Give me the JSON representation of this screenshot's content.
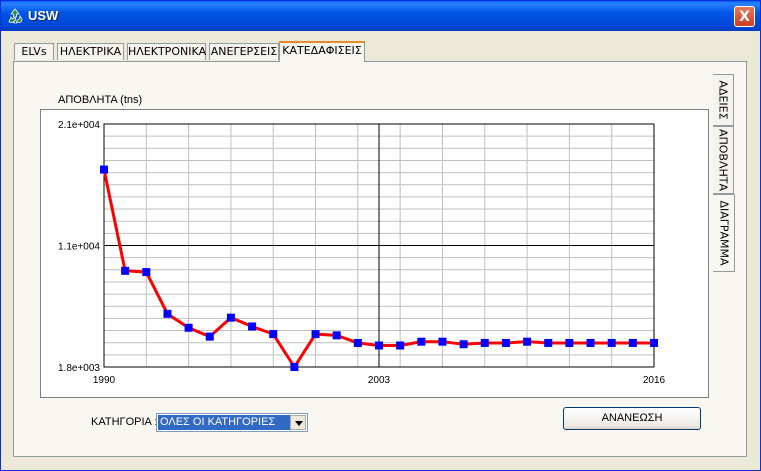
{
  "window": {
    "title": "USW",
    "close_label": "X",
    "icon": "recycle-icon"
  },
  "tabs": [
    {
      "label": "ELVs",
      "active": false
    },
    {
      "label": "ΗΛΕΚΤΡΙΚΑ",
      "active": false
    },
    {
      "label": "ΗΛΕΚΤΡΟΝΙΚΑ",
      "active": false
    },
    {
      "label": "ΑΝΕΓΕΡΣΕΙΣ",
      "active": false
    },
    {
      "label": "ΚΑΤΕΔΑΦΙΣΕΙΣ",
      "active": true
    }
  ],
  "side_tabs": [
    {
      "label": "ΑΔΕΙΕΣ",
      "active": false
    },
    {
      "label": "ΑΠΟΒΛΗΤΑ",
      "active": false
    },
    {
      "label": "ΔΙΑΓΡΑΜΜΑ",
      "active": true
    }
  ],
  "chart_data": {
    "type": "line",
    "ylabel": "ΑΠΟΒΛΗΤΑ (tns)",
    "x": [
      1990,
      1991,
      1992,
      1993,
      1994,
      1995,
      1996,
      1997,
      1998,
      1999,
      2000,
      2001,
      2002,
      2003,
      2004,
      2005,
      2006,
      2007,
      2008,
      2009,
      2010,
      2011,
      2012,
      2013,
      2014,
      2015,
      2016
    ],
    "series": [
      {
        "values": [
          17400,
          9400,
          9300,
          6000,
          4900,
          4200,
          5700,
          5000,
          4400,
          1800,
          4400,
          4300,
          3700,
          3500,
          3500,
          3800,
          3800,
          3600,
          3700,
          3700,
          3800,
          3700,
          3700,
          3700,
          3700,
          3700,
          3700
        ]
      }
    ],
    "xlim": [
      1990,
      2016
    ],
    "ylim": [
      1800,
      21000
    ],
    "x_ticks": [
      "1990",
      "2003",
      "2016"
    ],
    "y_ticks": [
      "1.8e+003",
      "1.1e+004",
      "2.1e+004"
    ],
    "grid": true,
    "line_color": "#ff0000",
    "marker_color": "#0000ff"
  },
  "controls": {
    "category_label": "ΚΑΤΗΓΟΡΙΑ :",
    "category_value": "ΟΛΕΣ ΟΙ ΚΑΤΗΓΟΡΙΕΣ",
    "refresh_label": "ΑΝΑΝΕΩΣΗ"
  }
}
